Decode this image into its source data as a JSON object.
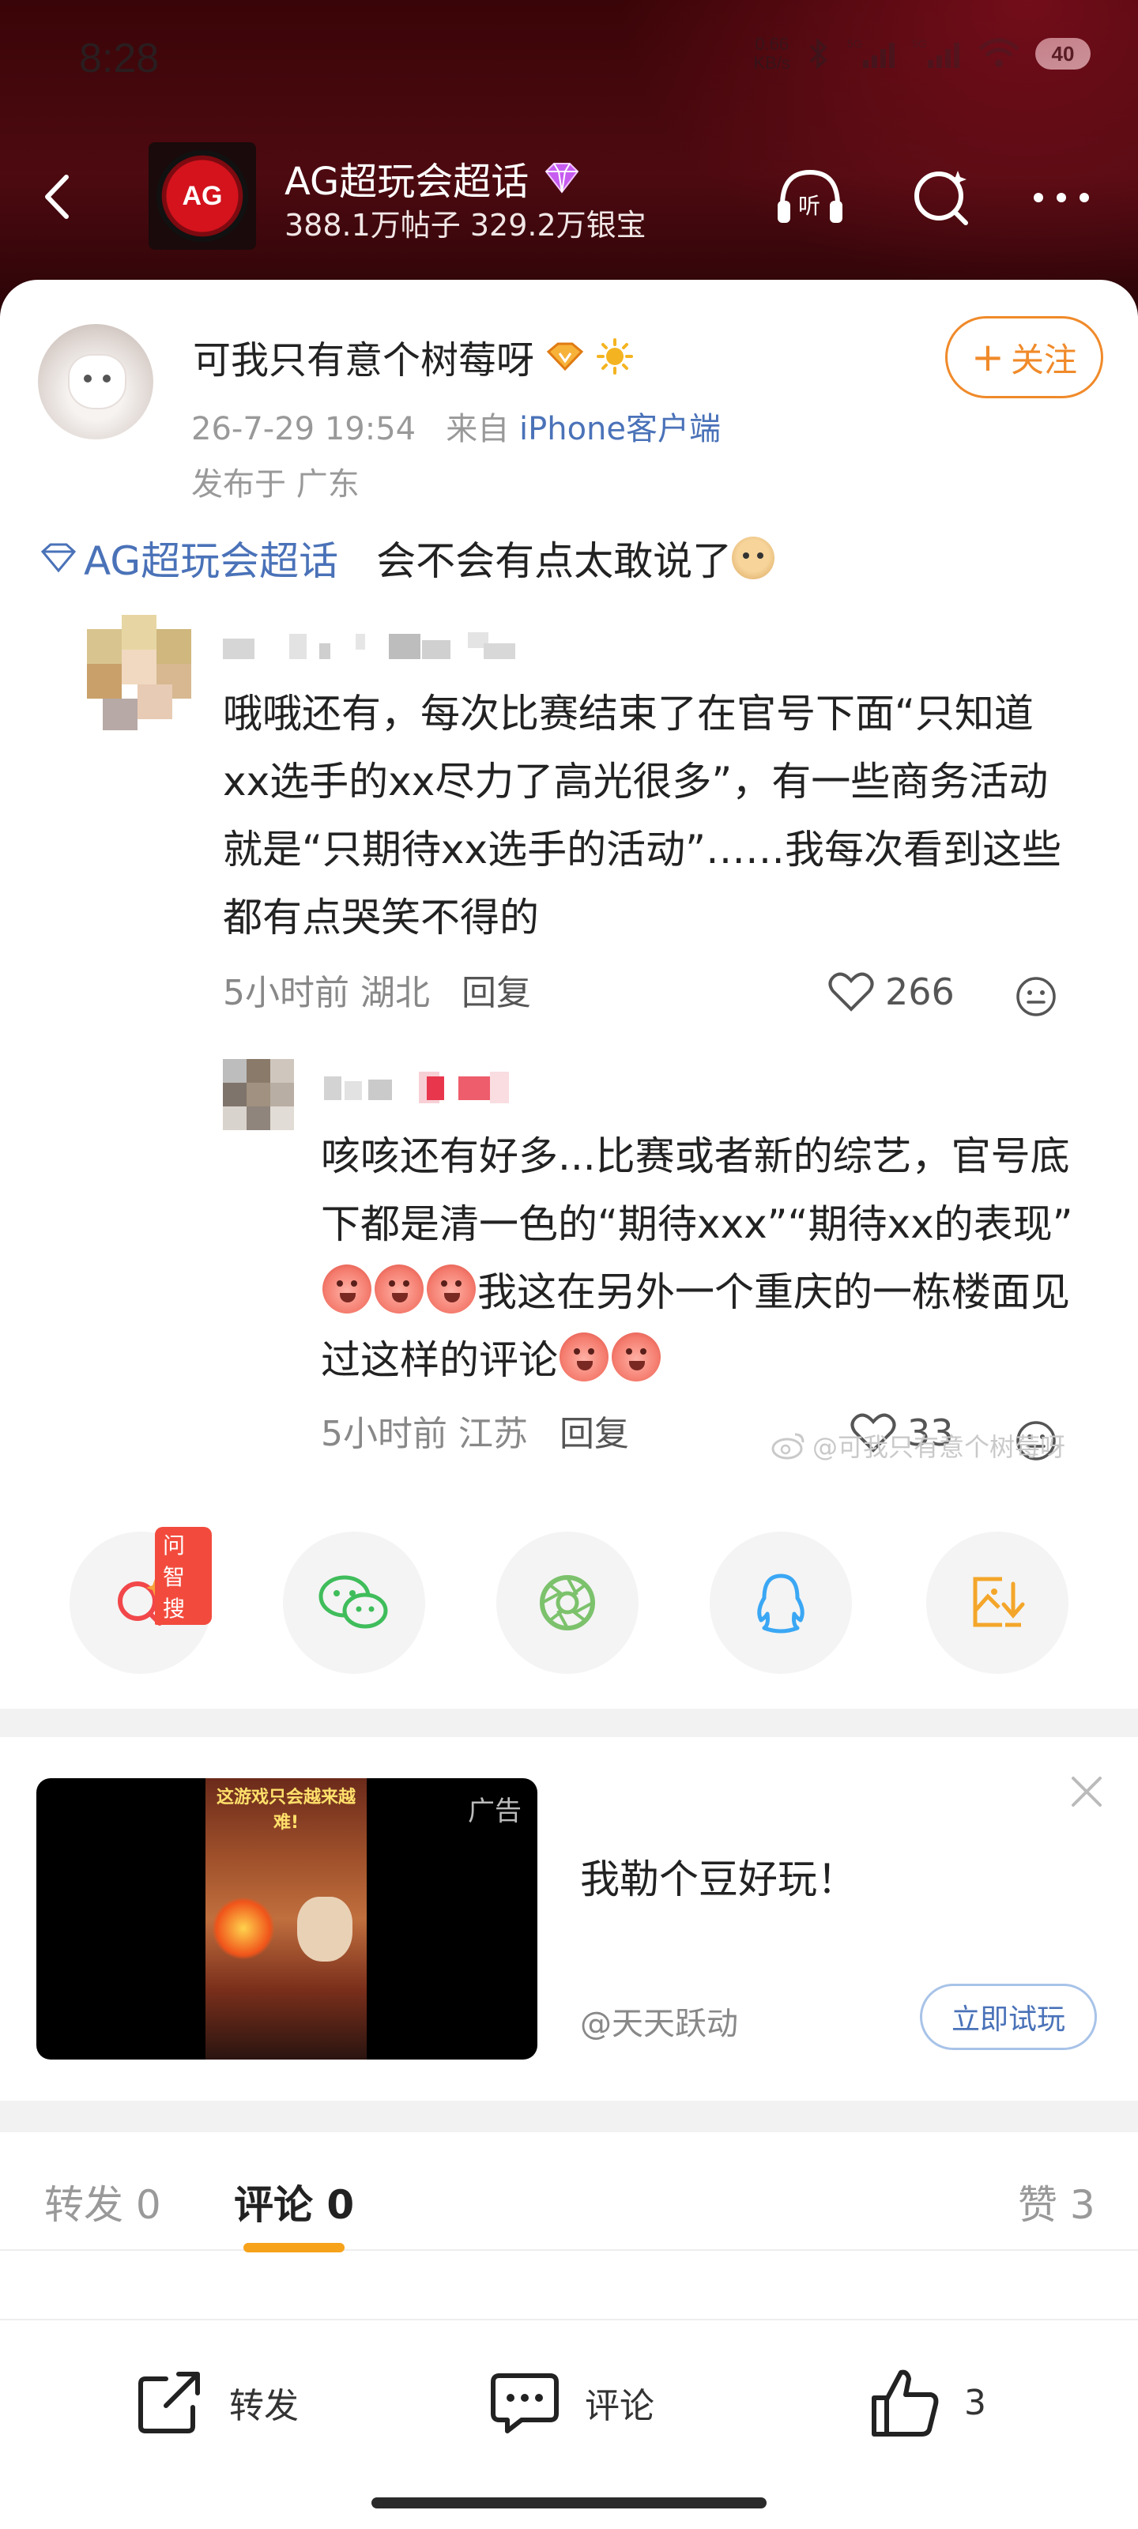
{
  "status": {
    "time": "8:28",
    "net_speed_value": "0.66",
    "net_speed_unit": "KB/s",
    "battery": "40"
  },
  "topic": {
    "logo_text": "AG",
    "name": "AG超玩会超话",
    "stats": "388.1万帖子  329.2万银宝"
  },
  "post": {
    "author": "可我只有意个树莓呀",
    "time": "26-7-29 19:54",
    "from_prefix": "来自",
    "source": "iPhone客户端",
    "location": "发布于 广东",
    "follow_label": "关注",
    "topic_link": "AG超玩会超话",
    "text": "会不会有点太敢说了"
  },
  "comments": [
    {
      "text": "哦哦还有，每次比赛结束了在官号下面“只知道xx选手的xx尽力了高光很多”，有一些商务活动就是“只期待xx选手的活动”……我每次看到这些都有点哭笑不得的",
      "time": "5小时前",
      "location": "湖北",
      "reply_label": "回复",
      "likes": "266"
    },
    {
      "text_a": "咳咳还有好多...比赛或者新的综艺，官号底下都是清一色的“期待xxx”“期待xx的表现”",
      "text_b": "我这在另外一个重庆的一栋楼面见过这样的评论",
      "time": "5小时前",
      "location": "江苏",
      "reply_label": "回复",
      "likes": "33"
    }
  ],
  "watermark": "@可我只有意个树莓呀",
  "share": {
    "search_tag": "问智搜",
    "items": [
      "search-ai-icon",
      "wechat-icon",
      "moments-icon",
      "qq-icon",
      "save-image-icon"
    ]
  },
  "ad": {
    "label": "广告",
    "game_caption": "这游戏只会越来越难!",
    "title": "我勒个豆好玩！",
    "advertiser": "@天天跃动",
    "cta": "立即试玩"
  },
  "tabs": {
    "repost": "转发 0",
    "comment": "评论 0",
    "like": "赞 3"
  },
  "bottom": {
    "repost": "转发",
    "comment": "评论",
    "like_count": "3"
  },
  "colors": {
    "header_bg": "#4d0a10",
    "accent_orange": "#f08a2a",
    "link_blue": "#4a72b8",
    "tab_underline": "#f6a21a"
  }
}
